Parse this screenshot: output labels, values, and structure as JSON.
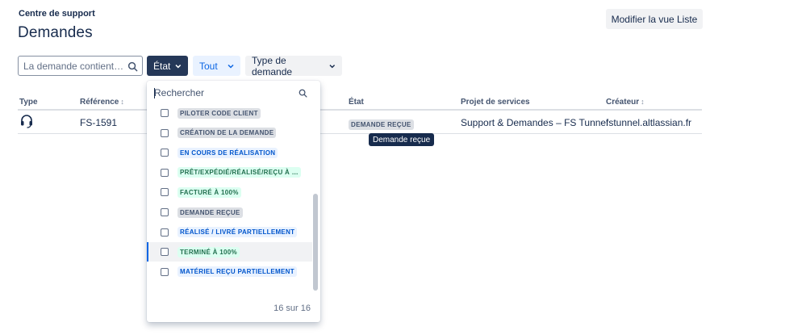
{
  "header": {
    "breadcrumb": "Centre de support",
    "title": "Demandes",
    "edit_list_label": "Modifier la vue Liste"
  },
  "filters": {
    "search_placeholder": "La demande contient…",
    "etat_label": "État",
    "tout_label": "Tout",
    "type_label": "Type de demande"
  },
  "table": {
    "columns": {
      "type": "Type",
      "reference": "Référence",
      "etat": "État",
      "projet": "Projet de services",
      "createur": "Créateur"
    },
    "rows": [
      {
        "reference": "FS-1591",
        "etat": "DEMANDE REÇUE",
        "projet": "Support & Demandes – FS Tunnel",
        "createur": "fstunnel.altlassian.fr"
      }
    ]
  },
  "tooltip": "Demande reçue",
  "dropdown": {
    "search_placeholder": "Rechercher",
    "options": [
      {
        "label": "PILOTER CODE CLIENT",
        "color": "grey"
      },
      {
        "label": "CRÉATION DE LA DEMANDE",
        "color": "grey"
      },
      {
        "label": "EN COURS DE RÉALISATION",
        "color": "blue"
      },
      {
        "label": "PRÊT/EXPÉDIÉ/RÉALISÉ/REÇU À …",
        "color": "green"
      },
      {
        "label": "FACTURÉ À 100%",
        "color": "green"
      },
      {
        "label": "DEMANDE REÇUE",
        "color": "grey"
      },
      {
        "label": "RÉALISÉ / LIVRÉ PARTIELLEMENT",
        "color": "blue"
      },
      {
        "label": "TERMINÉ À 100%",
        "color": "green"
      },
      {
        "label": "MATÉRIEL REÇU PARTIELLEMENT",
        "color": "blue"
      }
    ],
    "footer": "16 sur 16"
  },
  "colors": {
    "primary_dark": "#253858",
    "accent_blue": "#0c66e4",
    "text": "#172b4d"
  }
}
